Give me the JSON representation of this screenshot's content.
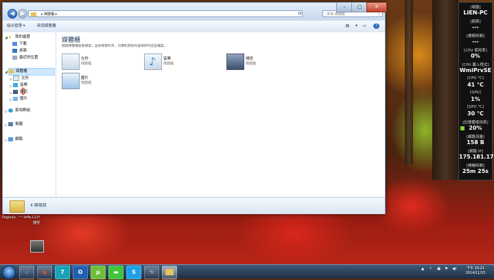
{
  "window": {
    "address_path": "媒體櫃",
    "search_placeholder": "搜尋 媒體櫃",
    "minimize": "–",
    "maximize": "□",
    "close": "✕",
    "toolbar": {
      "organize_label": "組合管理 ▾",
      "new_library_label": "新增媒體櫃"
    },
    "nav": {
      "favorites": "我的最愛",
      "downloads": "下載",
      "desktop": "桌面",
      "recent": "最近的位置",
      "libraries": "媒體櫃",
      "documents": "文件",
      "music": "音樂",
      "videos": "視訊",
      "pictures": "圖片",
      "homegroup": "家用群組",
      "computer": "電腦",
      "network": "網路"
    },
    "content": {
      "title": "媒體櫃",
      "description": "開啟媒體櫃查看檔案，並依照資料夾、日期和其他內容來排列這些檔案。",
      "items": [
        {
          "name": "文件",
          "type": "媒體櫃",
          "icon": "documents-library-icon"
        },
        {
          "name": "音樂",
          "type": "媒體櫃",
          "icon": "music-library-icon"
        },
        {
          "name": "視訊",
          "type": "媒體櫃",
          "icon": "videos-library-icon"
        },
        {
          "name": "圖片",
          "type": "媒體櫃",
          "icon": "pictures-library-icon"
        }
      ]
    },
    "status": "4 個項目"
  },
  "gadget": [
    {
      "label": "[電腦]",
      "value": "LIEN-PC"
    },
    {
      "label": "[筋斯]",
      "value": "---"
    },
    {
      "label": "[療癒時間]",
      "value": "---"
    },
    {
      "label": "[CPU 使用率]",
      "value": "0%"
    },
    {
      "label": "[CPU 載入程式]",
      "value": "WmiPrvSE"
    },
    {
      "label": "[CPU °C]",
      "value": "41 °C"
    },
    {
      "label": "[GPU]",
      "value": "1%"
    },
    {
      "label": "[GPU °C]",
      "value": "30 °C"
    },
    {
      "label": "[記憶體使用率]",
      "value": "20%"
    },
    {
      "label": "[網路流量]",
      "value": "158 B"
    },
    {
      "label": "[網路 IP]",
      "value": "175.181.17"
    },
    {
      "label": "[開機時間]",
      "value": "25m 25s"
    }
  ],
  "desktop": {
    "label_a": "Pagladu - 一 leffe.CCH",
    "label_b": "捷徑"
  },
  "clock": {
    "time": "下午 10:21",
    "date": "2014/11/15"
  },
  "colors": {
    "window_bg": "#ffffff",
    "title_accent": "#1e395b",
    "selection": "#cde8ff",
    "memory_bar": "#8bd12a"
  }
}
